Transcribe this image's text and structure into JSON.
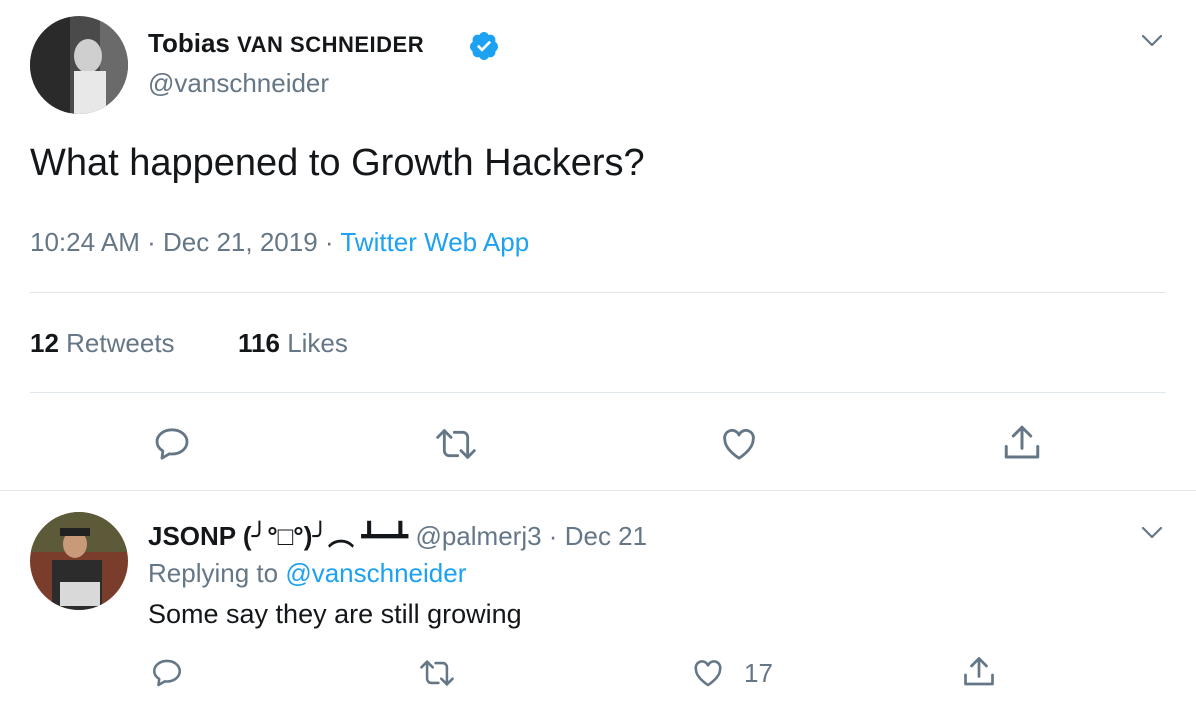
{
  "tweet": {
    "author": {
      "name": "Tobias",
      "name_caps": "VAN SCHNEIDER",
      "handle": "@vanschneider",
      "verified": true
    },
    "text": "What happened to Growth Hackers?",
    "time": "10:24 AM",
    "sep1": "·",
    "date": "Dec 21, 2019",
    "sep2": "·",
    "source": "Twitter Web App",
    "retweets_count": "12",
    "retweets_label": "Retweets",
    "likes_count": "116",
    "likes_label": "Likes",
    "actions": [
      "reply-icon",
      "retweet-icon",
      "like-icon",
      "share-icon"
    ]
  },
  "reply": {
    "author": {
      "name": "JSONP (╯°□°)╯︵ ┻━┻",
      "handle": "@palmerj3"
    },
    "sep": "·",
    "date": "Dec 21",
    "replying_prefix": "Replying to",
    "replying_handle": "@vanschneider",
    "text": "Some say they are still growing",
    "like_count": "17",
    "actions": [
      "reply-icon",
      "retweet-icon",
      "like-icon",
      "share-icon"
    ]
  },
  "colors": {
    "accent": "#1da1f2",
    "muted": "#657786",
    "text": "#14171a",
    "divider": "#e1e8ed"
  }
}
